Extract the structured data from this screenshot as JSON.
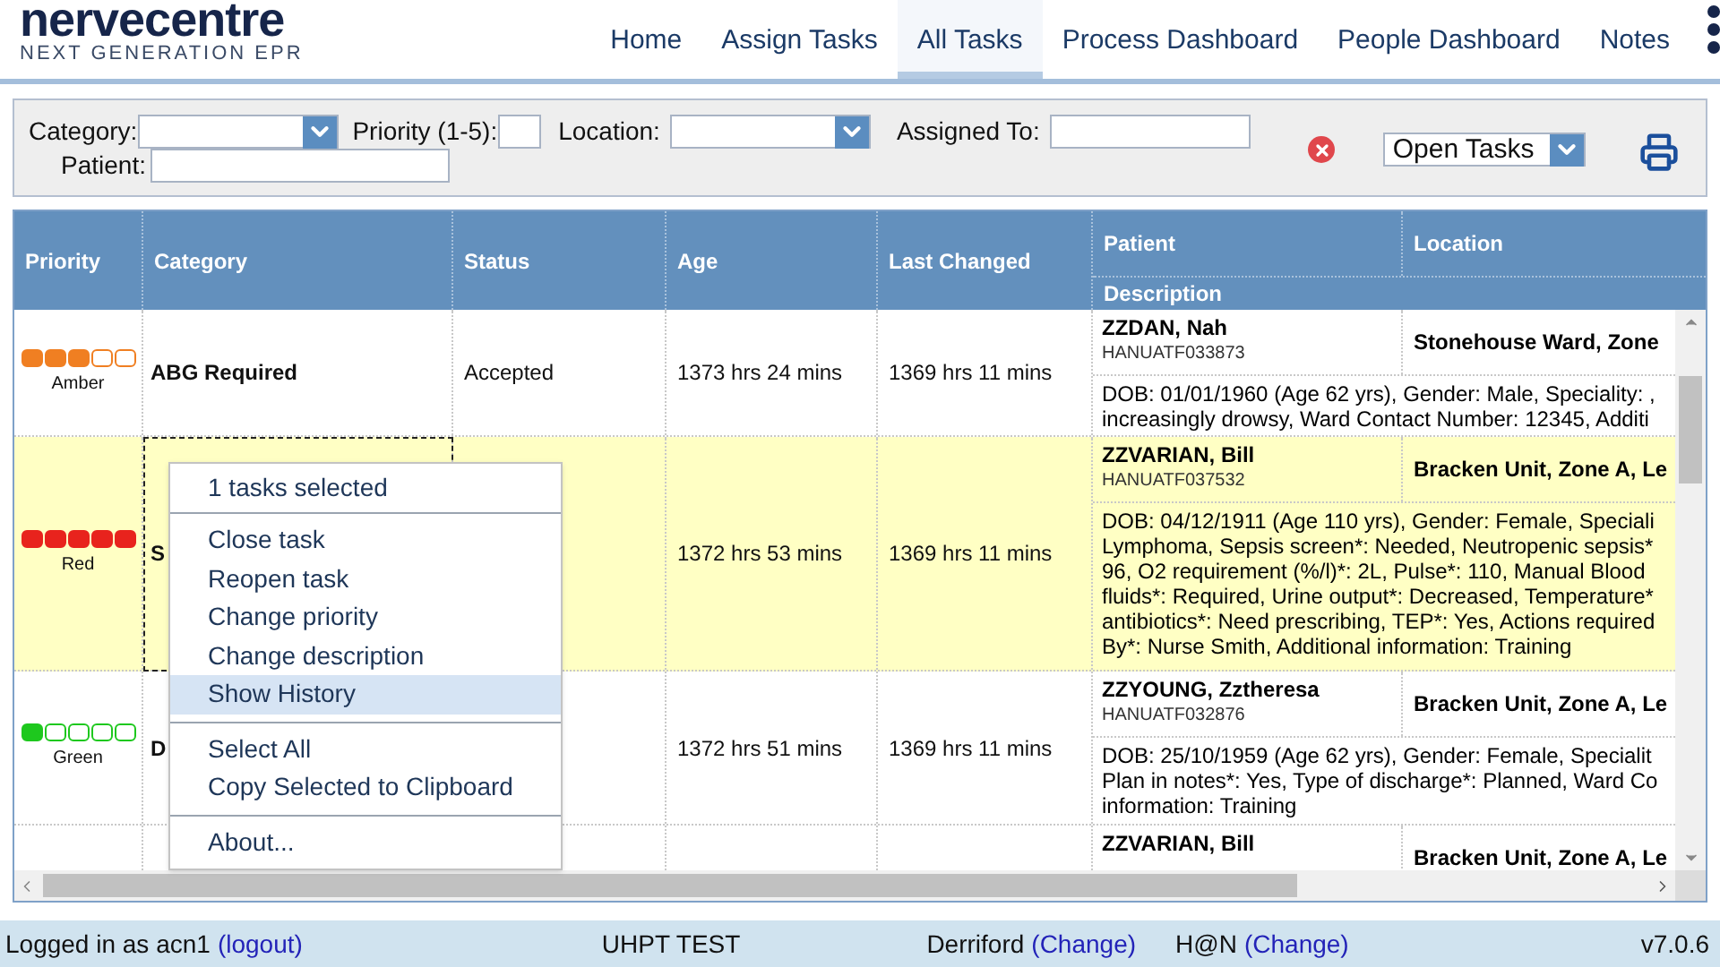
{
  "logo": {
    "name": "nervecentre",
    "tagline": "NEXT GENERATION EPR"
  },
  "nav": [
    {
      "label": "Home",
      "selected": false
    },
    {
      "label": "Assign Tasks",
      "selected": false
    },
    {
      "label": "All Tasks",
      "selected": true
    },
    {
      "label": "Process Dashboard",
      "selected": false
    },
    {
      "label": "People Dashboard",
      "selected": false
    },
    {
      "label": "Notes",
      "selected": false
    }
  ],
  "filters": {
    "category_label": "Category:",
    "priority_label": "Priority (1-5):",
    "location_label": "Location:",
    "assigned_label": "Assigned To:",
    "patient_label": "Patient:",
    "view": "Open Tasks"
  },
  "table": {
    "columns": [
      "Priority",
      "Category",
      "Status",
      "Age",
      "Last Changed",
      "Patient",
      "Location",
      "Description"
    ],
    "rows": [
      {
        "selected": false,
        "stars": 3,
        "color": "#f07f22",
        "priority": "Amber",
        "category": "ABG Required",
        "status": "Accepted",
        "age": "1373 hrs 24 mins",
        "last_changed": "1369 hrs 11 mins",
        "patient": "ZZDAN, Nah",
        "patient_id": "HANUATF033873",
        "location": "Stonehouse Ward, Zone",
        "description": [
          "DOB: 01/01/1960 (Age 62 yrs), Gender: Male, Speciality: ,",
          "increasingly drowsy, Ward Contact Number: 12345, Additi"
        ]
      },
      {
        "selected": true,
        "stars": 5,
        "color": "#e8231d",
        "priority": "Red",
        "category": "S",
        "status": "",
        "age": "1372 hrs 53 mins",
        "last_changed": "1369 hrs 11 mins",
        "patient": "ZZVARIAN, Bill",
        "patient_id": "HANUATF037532",
        "location": "Bracken Unit, Zone A, Le",
        "description": [
          "DOB: 04/12/1911 (Age 110 yrs), Gender: Female, Speciali",
          "Lymphoma, Sepsis screen*: Needed, Neutropenic sepsis*",
          "96, O2 requirement (%/l)*: 2L, Pulse*: 110, Manual Blood",
          "fluids*: Required, Urine output*: Decreased, Temperature*",
          "antibiotics*: Need prescribing, TEP*: Yes, Actions required",
          "By*: Nurse Smith, Additional information: Training"
        ]
      },
      {
        "selected": false,
        "stars": 1,
        "color": "#1ec81e",
        "priority": "Green",
        "category": "D",
        "status": "",
        "age": "1372 hrs 51 mins",
        "last_changed": "1369 hrs 11 mins",
        "patient": "ZZYOUNG, Zztheresa",
        "patient_id": "HANUATF032876",
        "location": "Bracken Unit, Zone A, Le",
        "description": [
          "DOB: 25/10/1959 (Age 62 yrs), Gender: Female, Specialit",
          "Plan in notes*: Yes, Type of discharge*: Planned, Ward Co",
          "information: Training"
        ]
      },
      {
        "selected": false,
        "patient": "ZZVARIAN, Bill",
        "location": "Bracken Unit, Zone A, Le"
      }
    ]
  },
  "context_menu": {
    "title": "1 tasks selected",
    "groups": [
      [
        {
          "label": "Close task",
          "selected": false
        },
        {
          "label": "Reopen task",
          "selected": false
        },
        {
          "label": "Change priority",
          "selected": false
        },
        {
          "label": "Change description",
          "selected": false
        },
        {
          "label": "Show History",
          "selected": true
        }
      ],
      [
        {
          "label": "Select All",
          "selected": false
        },
        {
          "label": "Copy Selected to Clipboard",
          "selected": false
        }
      ],
      [
        {
          "label": "About...",
          "selected": false
        }
      ]
    ]
  },
  "status_bar": {
    "user": "Logged in as acn1",
    "logout": "(logout)",
    "environment": "UHPT TEST",
    "site": "Derriford",
    "site_change": "(Change)",
    "service": "H@N",
    "service_change": "(Change)",
    "version": "v7.0.6"
  }
}
